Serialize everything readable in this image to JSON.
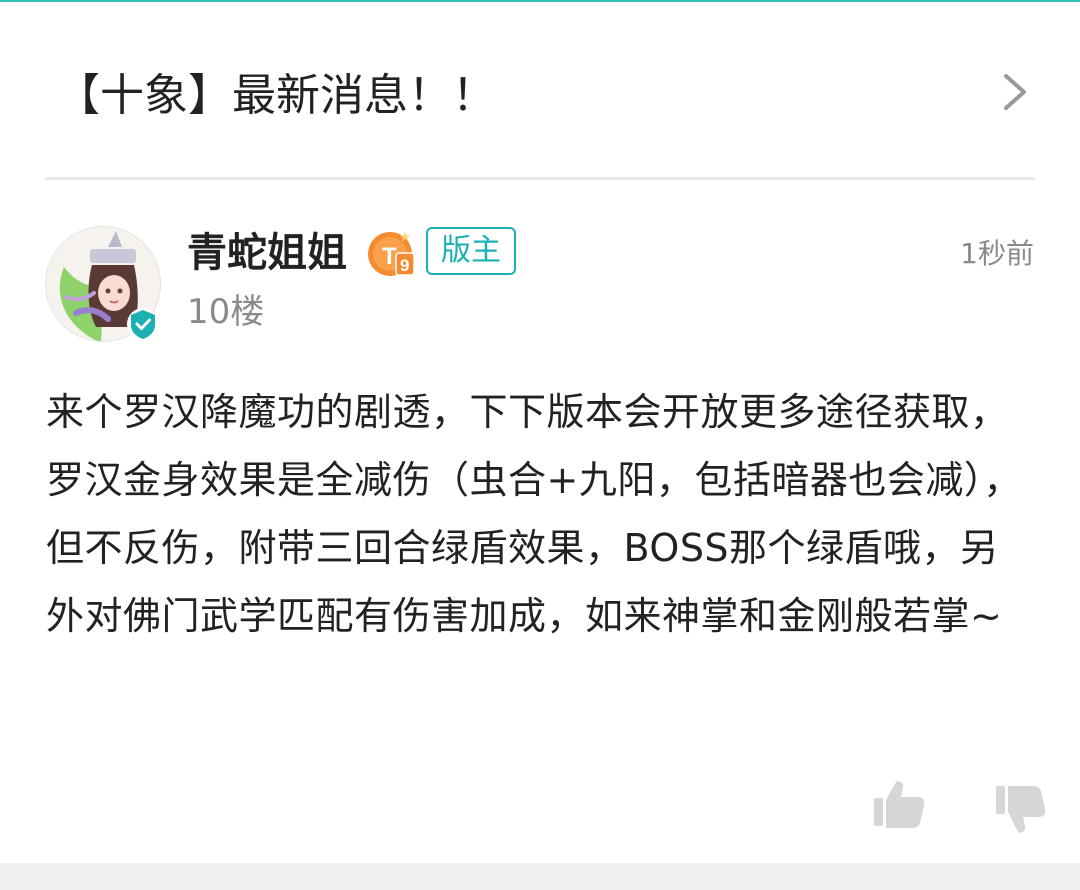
{
  "thread": {
    "title": "【十象】最新消息！！"
  },
  "post": {
    "username": "青蛇姐姐",
    "level_badge": "T9",
    "role_badge": "版主",
    "floor": "10楼",
    "time": "1秒前",
    "content": "来个罗汉降魔功的剧透，下下版本会开放更多途径获取，罗汉金身效果是全减伤（虫合+九阳，包括暗器也会减），但不反伤，附带三回合绿盾效果，BOSS那个绿盾哦，另外对佛门武学匹配有伤害加成，如来神掌和金刚般若掌~"
  },
  "icons": {
    "chevron": "chevron-right-icon",
    "verified": "verified-check-icon",
    "like": "thumbs-up-icon",
    "dislike": "thumbs-down-icon"
  },
  "colors": {
    "accent": "#1bb0b2",
    "level_badge": "#f58a2e",
    "muted_text": "#8a8a8a",
    "icon_gray": "#d6d6d6"
  }
}
